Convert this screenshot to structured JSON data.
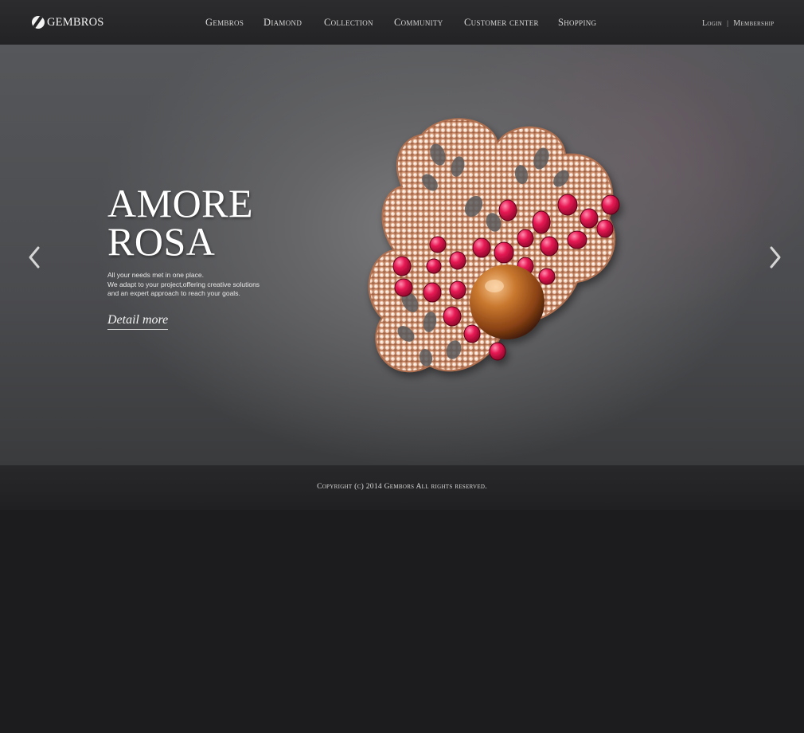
{
  "brand": {
    "name": "GEMBROS"
  },
  "nav": {
    "items": [
      {
        "label": "Gembros"
      },
      {
        "label": "Diamond"
      },
      {
        "label": "Collection"
      },
      {
        "label": "Community"
      },
      {
        "label": "Customer center"
      },
      {
        "label": "Shopping"
      }
    ]
  },
  "account": {
    "login": "Login",
    "separator": "|",
    "membership": "Membership"
  },
  "hero": {
    "title_line1": "AMORE",
    "title_line2": "ROSA",
    "description": [
      "All your needs met in one place.",
      "We adapt to your project,offering creative solutions",
      "and an expert approach to reach your goals."
    ],
    "link_label": "Detail more",
    "prev_icon": "chevron-left-icon",
    "next_icon": "chevron-right-icon",
    "image": "pearl-ruby-diamond-brooch"
  },
  "footer": {
    "copyright": "Copyright (c) 2014 Gembors All rights reserved."
  },
  "colors": {
    "header_bg": "#2a2a2c",
    "hero_bg": "#55575a",
    "footer_bg": "#252527",
    "page_bg": "#1c1c1e",
    "ruby": "#e0144a",
    "gold": "#d89a72",
    "pearl": "#b8651f"
  }
}
